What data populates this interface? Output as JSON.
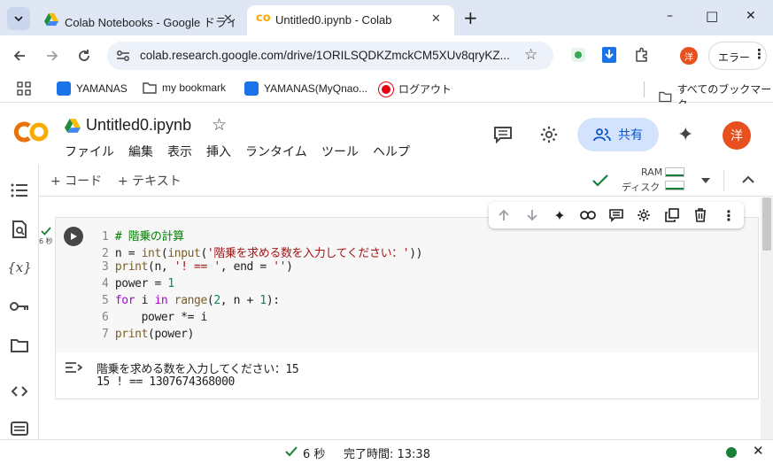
{
  "browser": {
    "tabs": [
      {
        "title": "Colab Notebooks - Google ドライ",
        "active": false
      },
      {
        "title": "Untitled0.ipynb - Colab",
        "active": true
      }
    ],
    "new_tab": "+",
    "window_controls": {
      "minimize": "–",
      "maximize": "□",
      "close": "✕"
    },
    "url": "colab.research.google.com/drive/1ORILSQDKZmckCM5XUv8qryKZ...",
    "error_button": "エラー",
    "profile_initial": "洋",
    "bookmarks": [
      {
        "label": "YAMANAS",
        "icon": "bookmark-site-icon"
      },
      {
        "label": "my bookmark",
        "icon": "folder-icon"
      },
      {
        "label": "YAMANAS(MyQnao...",
        "icon": "bookmark-site-icon"
      },
      {
        "label": "ログアウト",
        "icon": "mufg-icon"
      }
    ],
    "all_bookmarks": "すべてのブックマーク"
  },
  "colab": {
    "logo": "CO",
    "notebook_title": "Untitled0.ipynb",
    "menu": [
      "ファイル",
      "編集",
      "表示",
      "挿入",
      "ランタイム",
      "ツール",
      "ヘルプ"
    ],
    "share_label": "共有",
    "user_initial": "洋",
    "add_code": "+ コード",
    "add_text": "+ テキスト",
    "ram_label": "RAM",
    "disk_label": "ディスク",
    "accent": "#f9ab00",
    "run_status": "6 秒"
  },
  "cell": {
    "code_lines": [
      {
        "n": "1",
        "text": "# 階乗の計算"
      },
      {
        "n": "2",
        "text": "n = int(input('階乗を求める数を入力してください：'))"
      },
      {
        "n": "3",
        "text": "print(n, '! == ', end = '')"
      },
      {
        "n": "4",
        "text": "power = 1"
      },
      {
        "n": "5",
        "text": "for i in range(2, n + 1):"
      },
      {
        "n": "6",
        "text": "    power *= i"
      },
      {
        "n": "7",
        "text": "print(power)"
      }
    ],
    "output_lines": [
      "階乗を求める数を入力してください：15",
      "15 ! == 1307674368000"
    ]
  },
  "status": {
    "elapsed": "6 秒",
    "completed": "完了時間: 13:38"
  }
}
